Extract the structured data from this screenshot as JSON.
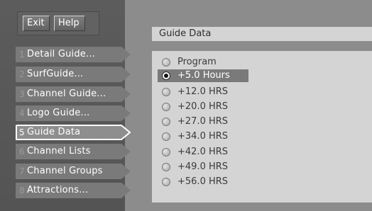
{
  "top_buttons": {
    "exit_label": "Exit",
    "help_label": "Help"
  },
  "menu": {
    "items": [
      {
        "number": "1",
        "label": "Detail Guide..."
      },
      {
        "number": "2",
        "label": "SurfGuide..."
      },
      {
        "number": "3",
        "label": "Channel Guide..."
      },
      {
        "number": "4",
        "label": "Logo Guide..."
      },
      {
        "number": "5",
        "label": "Guide Data"
      },
      {
        "number": "6",
        "label": "Channel Lists"
      },
      {
        "number": "7",
        "label": "Channel Groups"
      },
      {
        "number": "8",
        "label": "Attractions..."
      }
    ],
    "selected_index": 4
  },
  "guide_data": {
    "title": "Guide Data",
    "options": [
      {
        "label": "Program"
      },
      {
        "label": "+5.0 Hours"
      },
      {
        "label": "+12.0 HRS"
      },
      {
        "label": "+20.0 HRS"
      },
      {
        "label": "+27.0 HRS"
      },
      {
        "label": "+34.0 HRS"
      },
      {
        "label": "+42.0 HRS"
      },
      {
        "label": "+49.0 HRS"
      },
      {
        "label": "+56.0 HRS"
      }
    ],
    "selected_index": 1
  },
  "colors": {
    "background": "#6d6d6d",
    "panel": "#d4d4d4",
    "menu_item": "#7a7a7a",
    "highlight_text": "#ffffff"
  }
}
